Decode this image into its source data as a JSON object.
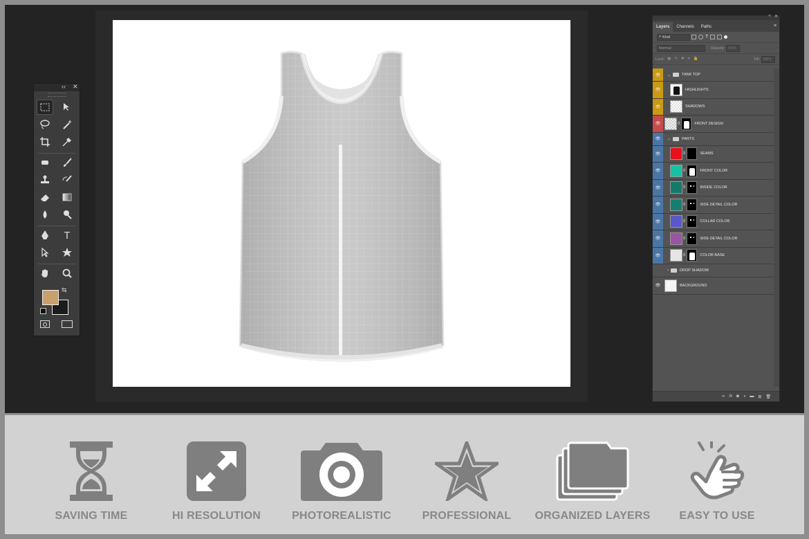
{
  "layers_panel": {
    "tabs": [
      "Layers",
      "Channels",
      "Paths"
    ],
    "filter_label": "Kind",
    "blend_mode": "Normal",
    "opacity_label": "Opacity:",
    "opacity_value": "100%",
    "lock_label": "Lock:",
    "fill_label": "Fill:",
    "fill_value": "100%",
    "layers": [
      {
        "name": "TANK TOP",
        "kind": "group",
        "tag": "#c99a12"
      },
      {
        "name": "HIGHLIGHTS",
        "kind": "layer",
        "tag": "#c99a12"
      },
      {
        "name": "SHADOWS",
        "kind": "layer",
        "tag": "#c99a12"
      },
      {
        "name": "FRONT DESIGN",
        "kind": "smart",
        "tag": "#c84a4a"
      },
      {
        "name": "PARTS",
        "kind": "group",
        "tag": "#4a76a6"
      },
      {
        "name": "SEAMS",
        "kind": "fill",
        "color": "#e8101a",
        "tag": "#4a76a6"
      },
      {
        "name": "FRONT COLOR",
        "kind": "fill",
        "color": "#14c3a4",
        "tag": "#4a76a6"
      },
      {
        "name": "INSIDE COLOR",
        "kind": "fill",
        "color": "#137a6a",
        "tag": "#4a76a6"
      },
      {
        "name": "SIDE DETAIL COLOR",
        "kind": "fill",
        "color": "#167e70",
        "tag": "#4a76a6"
      },
      {
        "name": "COLLAR COLOR",
        "kind": "fill",
        "color": "#5a58c8",
        "tag": "#4a76a6"
      },
      {
        "name": "SIDE DETAIL COLOR",
        "kind": "fill",
        "color": "#9a55a2",
        "tag": "#4a76a6"
      },
      {
        "name": "COLOR BASE",
        "kind": "fill",
        "color": "#e6e6e6",
        "tag": "#4a76a6"
      },
      {
        "name": "DROP SHADOW",
        "kind": "group",
        "tag": ""
      },
      {
        "name": "BACKGROUND",
        "kind": "layer",
        "tag": ""
      }
    ]
  },
  "toolbox": {
    "foreground_color": "#c9a06c",
    "background_color": "#1b1b1b"
  },
  "features": [
    {
      "label": "SAVING TIME",
      "icon": "hourglass-icon"
    },
    {
      "label": "HI RESOLUTION",
      "icon": "expand-icon"
    },
    {
      "label": "PHOTOREALISTIC",
      "icon": "camera-icon"
    },
    {
      "label": "PROFESSIONAL",
      "icon": "star-icon"
    },
    {
      "label": "ORGANIZED LAYERS",
      "icon": "layers-folder-icon"
    },
    {
      "label": "EASY TO USE",
      "icon": "tap-hand-icon"
    }
  ],
  "colors": {
    "workspace": "#232323",
    "feature_icon": "#7f7f7f",
    "feature_text": "#888888"
  }
}
